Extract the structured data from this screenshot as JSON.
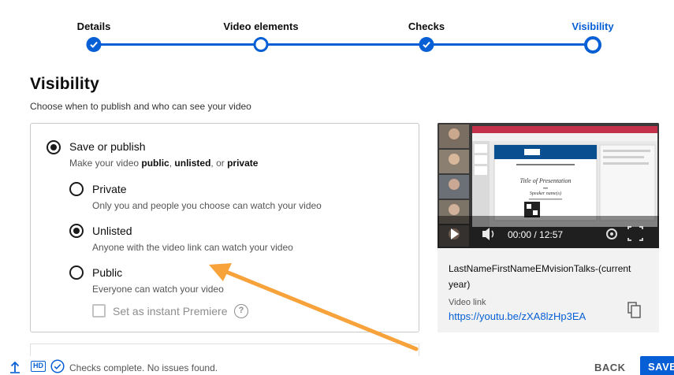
{
  "stepper": {
    "steps": [
      {
        "label": "Details",
        "state": "done"
      },
      {
        "label": "Video elements",
        "state": "current-ring"
      },
      {
        "label": "Checks",
        "state": "done"
      },
      {
        "label": "Visibility",
        "state": "active"
      }
    ]
  },
  "page": {
    "title": "Visibility",
    "subtitle": "Choose when to publish and who can see your video"
  },
  "options": {
    "save_or_publish": {
      "title": "Save or publish",
      "desc_prefix": "Make your video ",
      "desc_public": "public",
      "desc_sep1": ", ",
      "desc_unlisted": "unlisted",
      "desc_sep2": ", or ",
      "desc_private": "private",
      "selected": true
    },
    "private": {
      "title": "Private",
      "desc": "Only you and people you choose can watch your video",
      "selected": false
    },
    "unlisted": {
      "title": "Unlisted",
      "desc": "Anyone with the video link can watch your video",
      "selected": true
    },
    "public": {
      "title": "Public",
      "desc": "Everyone can watch your video",
      "selected": false
    },
    "premiere": {
      "label": "Set as instant Premiere",
      "help": "?",
      "checked": false
    }
  },
  "video": {
    "time": "00:00 / 12:57",
    "slide_title": "Title of Presentation",
    "slide_subtitle": "Speaker name(s)",
    "filename": "LastNameFirstNameEMvisionTalks-(current year)",
    "link_label": "Video link",
    "link": "https://youtu.be/zXA8lzHp3EA"
  },
  "footer": {
    "hd_badge": "HD",
    "status": "Checks complete. No issues found.",
    "back_label": "BACK",
    "save_label": "SAVE"
  },
  "colors": {
    "accent": "#065fd4",
    "annotation_arrow": "#f7a23b"
  }
}
